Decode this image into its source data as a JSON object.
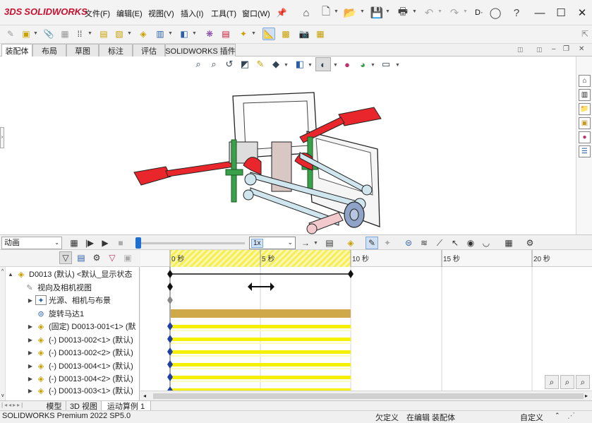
{
  "titlebar": {
    "logo_mark": "3DS",
    "logo_text": "SOLIDWORKS",
    "menus": [
      "文件(F)",
      "编辑(E)",
      "视图(V)",
      "插入(I)",
      "工具(T)",
      "窗口(W)"
    ],
    "truncated_label": "D·"
  },
  "tabs": [
    {
      "label": "装配体",
      "active": true
    },
    {
      "label": "布局",
      "active": false
    },
    {
      "label": "草图",
      "active": false
    },
    {
      "label": "标注",
      "active": false
    },
    {
      "label": "评估",
      "active": false
    },
    {
      "label": "SOLIDWORKS 插件",
      "active": false
    }
  ],
  "motion": {
    "study_type": "动画",
    "speed": "1x",
    "ruler": [
      "0 秒",
      "5 秒",
      "10 秒",
      "15 秒",
      "20 秒"
    ]
  },
  "tree": {
    "items": [
      {
        "label": "D0013 (默认) <默认_显示状态",
        "expand": "▲"
      },
      {
        "label": "视向及相机视图",
        "expand": ""
      },
      {
        "label": "光源、相机与布景",
        "expand": "▶"
      },
      {
        "label": "旋转马达1",
        "expand": ""
      },
      {
        "label": "(固定) D0013-001<1> (默",
        "expand": "▶"
      },
      {
        "label": "(-) D0013-002<1> (默认)",
        "expand": "▶"
      },
      {
        "label": "(-) D0013-002<2> (默认)",
        "expand": "▶"
      },
      {
        "label": "(-) D0013-004<1> (默认)",
        "expand": "▶"
      },
      {
        "label": "(-) D0013-004<2> (默认)",
        "expand": "▶"
      },
      {
        "label": "(-) D0013-003<1> (默认)",
        "expand": "▶"
      }
    ]
  },
  "bottom_tabs": [
    "模型",
    "3D 视图",
    "运动算例 1"
  ],
  "status": {
    "product": "SOLIDWORKS Premium 2022 SP5.0",
    "state1": "欠定义",
    "state2": "在编辑 装配体",
    "units": "自定义"
  },
  "colors": {
    "red_part": "#e8262b",
    "green_part": "#3aa04a",
    "timeline_yellow": "#f5f000",
    "motor_bar": "#cfa84a",
    "keyframe_blue": "#1f3fa6"
  }
}
